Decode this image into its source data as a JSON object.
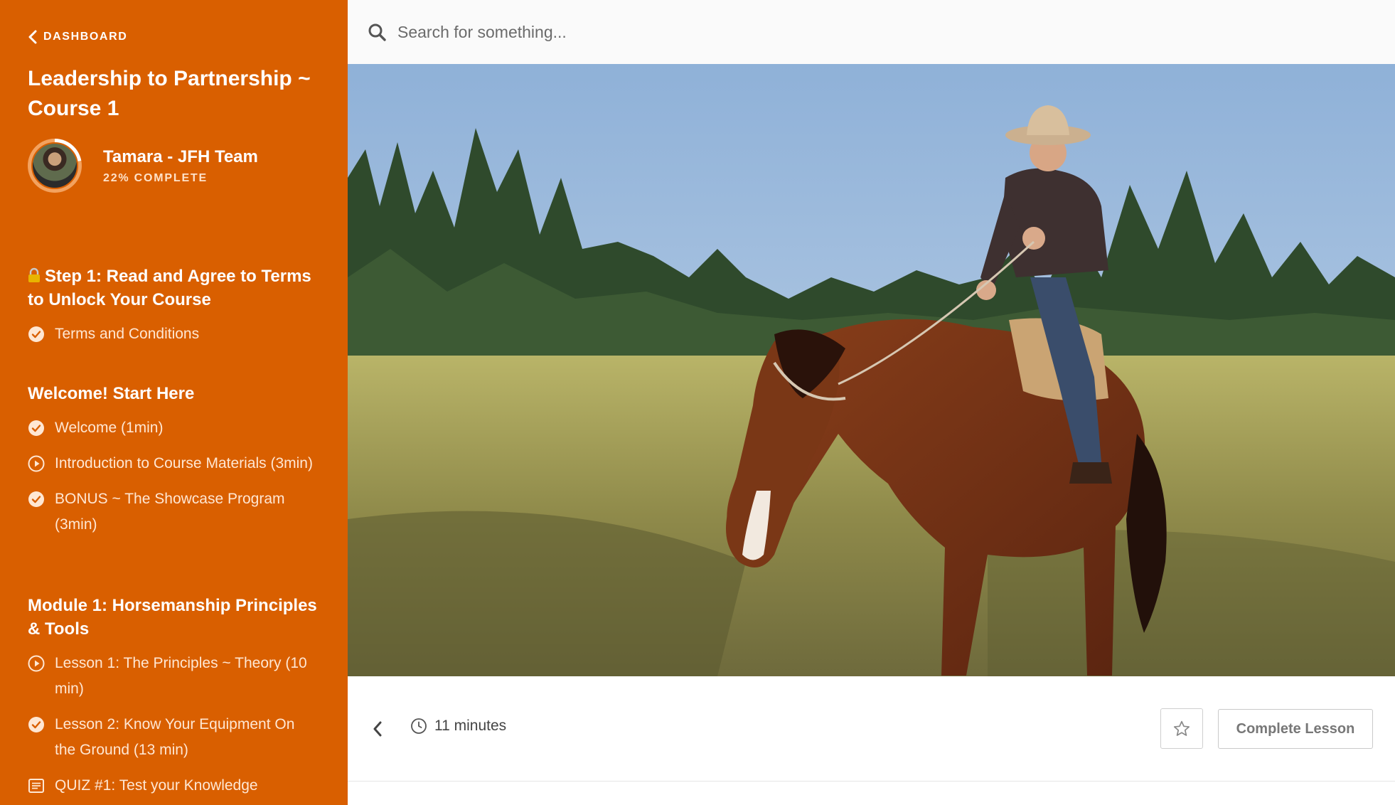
{
  "sidebar": {
    "back_label": "DASHBOARD",
    "course_title": "Leadership to Partnership ~ Course 1",
    "user": {
      "name": "Tamara - JFH Team",
      "progress_label": "22% COMPLETE",
      "progress": 0.22
    },
    "sections": [
      {
        "title": "Step 1: Read and Agree to Terms to Unlock Your Course",
        "icon": "lock-icon",
        "lessons": [
          {
            "label": "Terms and Conditions",
            "icon": "completed-check-icon"
          }
        ]
      },
      {
        "title": "Welcome! Start Here",
        "lessons": [
          {
            "label": "Welcome (1min)",
            "icon": "completed-check-icon"
          },
          {
            "label": "Introduction to Course Materials (3min)",
            "icon": "play-circle-icon"
          },
          {
            "label": "BONUS ~ The Showcase Program (3min)",
            "icon": "completed-check-icon"
          }
        ]
      },
      {
        "title": "Module 1: Horsemanship Principles & Tools",
        "lessons": [
          {
            "label": "Lesson 1: The Principles ~ Theory (10 min)",
            "icon": "play-circle-icon"
          },
          {
            "label": "Lesson 2: Know Your Equipment On the Ground (13 min)",
            "icon": "completed-check-icon"
          },
          {
            "label": "QUIZ #1: Test your Knowledge",
            "icon": "quiz-list-icon"
          }
        ]
      }
    ]
  },
  "search": {
    "placeholder": "Search for something..."
  },
  "lesson_controls": {
    "duration": "11 minutes",
    "complete_label": "Complete Lesson"
  },
  "colors": {
    "sidebar": "#d95f00",
    "accent_text": "#ffe2c9"
  }
}
